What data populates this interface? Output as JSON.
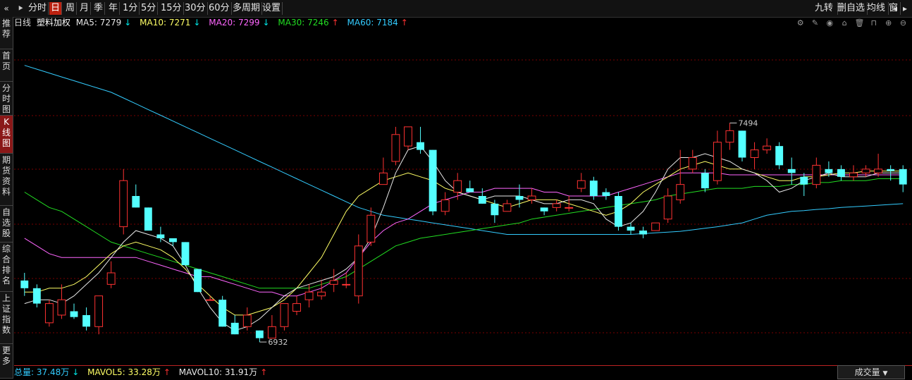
{
  "toolbar": {
    "collapse_glyph": "«",
    "play_glyph": "⯈",
    "periods": [
      "分时",
      "日",
      "周",
      "月",
      "季",
      "年",
      "1分",
      "5分",
      "15分",
      "30分",
      "60分",
      "多周期",
      "设置"
    ],
    "active_period": "日",
    "right_buttons": [
      "九转",
      "删自选",
      "均线",
      "窗"
    ],
    "nav_left": "◂",
    "nav_right": "▸"
  },
  "sidebar": {
    "items": [
      "推荐",
      "首页",
      "分时图",
      "K线图",
      "期货资料",
      "自选股",
      "综合排名",
      "上证指数",
      "更多"
    ],
    "active": "K线图"
  },
  "info": {
    "period": "日线",
    "name": "塑料加权",
    "ma5": "MA5: 7279",
    "ma5_dir": "↓",
    "ma10": "MA10: 7271",
    "ma10_dir": "↓",
    "ma20": "MA20: 7299",
    "ma20_dir": "↓",
    "ma30": "MA30: 7246",
    "ma30_dir": "↑",
    "ma60": "MA60: 7184",
    "ma60_dir": "↑"
  },
  "colors": {
    "up": "#ff3232",
    "down": "#54ffff",
    "ma5": "#e8e8e8",
    "ma10": "#ffff66",
    "ma20": "#ff66ff",
    "ma30": "#22dd22",
    "ma60": "#33ccff",
    "grid": "#7a0000"
  },
  "icons": [
    "gear-icon",
    "pen-icon",
    "eye-icon",
    "basket-icon",
    "trash-icon",
    "lock-icon",
    "zoom-in-icon",
    "zoom-out-icon"
  ],
  "volume": {
    "total": "总量: 37.48万",
    "total_dir": "↓",
    "mavol5": "MAVOL5: 33.28万",
    "mavol5_dir": "↑",
    "mavol10": "MAVOL10: 31.91万",
    "mavol10_dir": "↑",
    "selector": "成交量",
    "selector_arrow": "▼"
  },
  "chart_data": {
    "type": "candlestick",
    "high_label": "7494",
    "low_label": "6932",
    "ylim": [
      6900,
      7700
    ],
    "candles": [
      [
        7080,
        7060,
        7100,
        7040
      ],
      [
        7060,
        7020,
        7070,
        7010
      ],
      [
        6970,
        7020,
        7030,
        6960
      ],
      [
        6990,
        7030,
        7070,
        6980
      ],
      [
        7000,
        6985,
        7020,
        6980
      ],
      [
        6990,
        6960,
        7010,
        6950
      ],
      [
        6960,
        7040,
        7040,
        6940
      ],
      [
        7070,
        7100,
        7130,
        7060
      ],
      [
        7220,
        7340,
        7370,
        7200
      ],
      [
        7300,
        7270,
        7330,
        7270
      ],
      [
        7270,
        7210,
        7270,
        7210
      ],
      [
        7200,
        7190,
        7220,
        7180
      ],
      [
        7190,
        7180,
        7190,
        7170
      ],
      [
        7180,
        7120,
        7180,
        7120
      ],
      [
        7110,
        7050,
        7110,
        7050
      ],
      [
        7030,
        7030,
        7040,
        7030
      ],
      [
        7030,
        6960,
        7040,
        6960
      ],
      [
        6970,
        6940,
        6990,
        6940
      ],
      [
        6960,
        6990,
        7010,
        6950
      ],
      [
        6950,
        6930,
        6950,
        6920
      ],
      [
        6930,
        6960,
        6990,
        6930
      ],
      [
        6960,
        7020,
        7020,
        6950
      ],
      [
        7000,
        7020,
        7040,
        6990
      ],
      [
        7030,
        7050,
        7070,
        7010
      ],
      [
        7040,
        7050,
        7080,
        7030
      ],
      [
        7070,
        7080,
        7110,
        7050
      ],
      [
        7070,
        7070,
        7100,
        7060
      ],
      [
        7040,
        7170,
        7200,
        7020
      ],
      [
        7180,
        7250,
        7270,
        7170
      ],
      [
        7330,
        7360,
        7400,
        7330
      ],
      [
        7390,
        7460,
        7480,
        7380
      ],
      [
        7430,
        7480,
        7480,
        7420
      ],
      [
        7440,
        7420,
        7480,
        7410
      ],
      [
        7420,
        7260,
        7420,
        7250
      ],
      [
        7260,
        7290,
        7310,
        7250
      ],
      [
        7310,
        7340,
        7360,
        7290
      ],
      [
        7320,
        7310,
        7340,
        7310
      ],
      [
        7300,
        7280,
        7320,
        7280
      ],
      [
        7280,
        7250,
        7290,
        7230
      ],
      [
        7260,
        7280,
        7290,
        7260
      ],
      [
        7300,
        7290,
        7330,
        7270
      ],
      [
        7290,
        7300,
        7320,
        7280
      ],
      [
        7270,
        7260,
        7270,
        7250
      ],
      [
        7270,
        7280,
        7290,
        7260
      ],
      [
        7270,
        7270,
        7300,
        7260
      ],
      [
        7320,
        7340,
        7360,
        7310
      ],
      [
        7340,
        7300,
        7350,
        7290
      ],
      [
        7310,
        7300,
        7320,
        7290
      ],
      [
        7300,
        7220,
        7310,
        7210
      ],
      [
        7220,
        7210,
        7230,
        7200
      ],
      [
        7210,
        7200,
        7220,
        7190
      ],
      [
        7210,
        7230,
        7230,
        7210
      ],
      [
        7240,
        7300,
        7320,
        7230
      ],
      [
        7290,
        7330,
        7420,
        7280
      ],
      [
        7370,
        7400,
        7420,
        7360
      ],
      [
        7360,
        7320,
        7370,
        7310
      ],
      [
        7340,
        7440,
        7470,
        7330
      ],
      [
        7440,
        7470,
        7490,
        7420
      ],
      [
        7470,
        7400,
        7470,
        7390
      ],
      [
        7400,
        7420,
        7440,
        7370
      ],
      [
        7420,
        7430,
        7450,
        7410
      ],
      [
        7430,
        7380,
        7440,
        7370
      ],
      [
        7370,
        7360,
        7400,
        7330
      ],
      [
        7350,
        7330,
        7360,
        7300
      ],
      [
        7330,
        7380,
        7400,
        7320
      ],
      [
        7370,
        7360,
        7390,
        7350
      ],
      [
        7370,
        7350,
        7380,
        7340
      ],
      [
        7350,
        7360,
        7380,
        7340
      ],
      [
        7360,
        7370,
        7380,
        7350
      ],
      [
        7360,
        7370,
        7410,
        7350
      ],
      [
        7370,
        7365,
        7380,
        7340
      ],
      [
        7370,
        7330,
        7380,
        7310
      ]
    ],
    "ma5": [
      7020,
      7030,
      7030,
      7020,
      7040,
      7070,
      7100,
      7140,
      7180,
      7210,
      7200,
      7190,
      7170,
      7120,
      7060,
      7010,
      6970,
      6950,
      6960,
      6980,
      7010,
      7040,
      7060,
      7070,
      7080,
      7090,
      7110,
      7140,
      7190,
      7270,
      7360,
      7420,
      7430,
      7390,
      7340,
      7310,
      7300,
      7290,
      7300,
      7300,
      7300,
      7290,
      7280,
      7280,
      7290,
      7290,
      7280,
      7240,
      7220,
      7230,
      7260,
      7310,
      7370,
      7400,
      7400,
      7410,
      7400,
      7390,
      7370,
      7360,
      7340,
      7310,
      7320,
      7340,
      7350,
      7360,
      7350,
      7350,
      7350,
      7360,
      7360,
      7360
    ],
    "ma10": [
      7050,
      7050,
      7060,
      7060,
      7070,
      7090,
      7120,
      7150,
      7170,
      7180,
      7170,
      7160,
      7140,
      7110,
      7070,
      7040,
      7010,
      6990,
      6990,
      7000,
      7010,
      7030,
      7060,
      7100,
      7140,
      7200,
      7260,
      7300,
      7320,
      7340,
      7350,
      7360,
      7350,
      7340,
      7320,
      7310,
      7300,
      7290,
      7280,
      7270,
      7280,
      7290,
      7290,
      7290,
      7280,
      7270,
      7260,
      7250,
      7260,
      7280,
      7310,
      7330,
      7350,
      7370,
      7380,
      7390,
      7380,
      7370,
      7370,
      7360,
      7350,
      7340,
      7340,
      7350,
      7350,
      7355,
      7360,
      7360,
      7365,
      7365,
      7365,
      7365
    ],
    "ma20": [
      7190,
      7170,
      7150,
      7140,
      7140,
      7140,
      7140,
      7140,
      7140,
      7140,
      7130,
      7120,
      7110,
      7100,
      7090,
      7090,
      7080,
      7070,
      7060,
      7050,
      7050,
      7040,
      7040,
      7050,
      7060,
      7080,
      7100,
      7140,
      7180,
      7210,
      7230,
      7240,
      7260,
      7280,
      7290,
      7300,
      7310,
      7310,
      7320,
      7320,
      7320,
      7320,
      7310,
      7310,
      7300,
      7300,
      7300,
      7300,
      7310,
      7320,
      7330,
      7340,
      7350,
      7360,
      7360,
      7360,
      7360,
      7355,
      7355,
      7355,
      7355,
      7355,
      7355,
      7355,
      7355,
      7355,
      7355,
      7355,
      7355,
      7355,
      7355,
      7355
    ],
    "ma30": [
      7310,
      7290,
      7270,
      7260,
      7240,
      7220,
      7200,
      7180,
      7170,
      7160,
      7150,
      7140,
      7130,
      7120,
      7110,
      7100,
      7090,
      7080,
      7070,
      7060,
      7060,
      7060,
      7060,
      7060,
      7070,
      7080,
      7090,
      7110,
      7130,
      7150,
      7170,
      7180,
      7190,
      7195,
      7200,
      7205,
      7210,
      7215,
      7220,
      7225,
      7230,
      7240,
      7245,
      7250,
      7255,
      7260,
      7265,
      7270,
      7275,
      7280,
      7285,
      7290,
      7300,
      7305,
      7310,
      7315,
      7320,
      7320,
      7320,
      7325,
      7325,
      7325,
      7330,
      7330,
      7335,
      7335,
      7340,
      7340,
      7340,
      7345,
      7345,
      7345
    ],
    "ma60": [
      7640,
      7630,
      7620,
      7610,
      7600,
      7590,
      7580,
      7570,
      7555,
      7540,
      7525,
      7510,
      7495,
      7480,
      7465,
      7450,
      7435,
      7420,
      7405,
      7390,
      7375,
      7360,
      7345,
      7330,
      7315,
      7300,
      7285,
      7270,
      7260,
      7250,
      7245,
      7240,
      7235,
      7230,
      7225,
      7220,
      7215,
      7210,
      7205,
      7200,
      7200,
      7200,
      7200,
      7200,
      7200,
      7200,
      7200,
      7200,
      7200,
      7200,
      7202,
      7204,
      7206,
      7208,
      7212,
      7216,
      7220,
      7225,
      7230,
      7240,
      7250,
      7255,
      7260,
      7262,
      7265,
      7267,
      7270,
      7272,
      7274,
      7276,
      7278,
      7280
    ]
  }
}
